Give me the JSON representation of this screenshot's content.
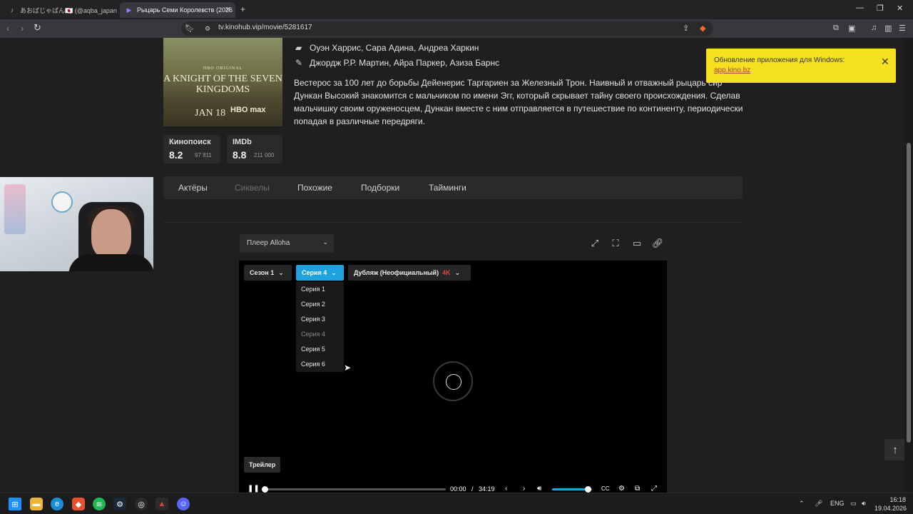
{
  "browser": {
    "tabs": [
      {
        "title": "あおばじゃぱん🇯🇵 (@aqba_japan) | Ti",
        "icon": "tiktok-icon"
      },
      {
        "title": "Рыцарь Семи Королевств (2026",
        "icon": "play-icon"
      }
    ],
    "url": "tv.kinohub.vip/movie/5281617"
  },
  "movie": {
    "cast": "Оуэн Харрис, Сара Адина, Андреа Харкин",
    "writers": "Джордж Р.Р. Мартин, Айра Паркер, Азиза Барнс",
    "description": "Вестерос за 100 лет до борьбы Дейенерис Таргариен за Железный Трон. Наивный и отважный рыцарь сир Дункан Высокий знакомится с мальчиком по имени Эгг, который скрывает тайну своего происхождения. Сделав мальчишку своим оруженосцем, Дункан вместе с ним отправляется в путешествие по континенту, периодически попадая в различные передряги.",
    "poster": {
      "hbo": "HBO ORIGINAL",
      "title": "A KNIGHT OF THE SEVEN KINGDOMS",
      "date": "JAN 18",
      "brand": "HBO max"
    },
    "ratings": [
      {
        "name": "Кинопоиск",
        "value": "8.2",
        "votes": "97 811"
      },
      {
        "name": "IMDb",
        "value": "8.8",
        "votes": "211 000"
      }
    ]
  },
  "page_tabs": [
    "Актёры",
    "Сиквелы",
    "Похожие",
    "Подборки",
    "Тайминги"
  ],
  "player": {
    "selector": "Плеер Alloha",
    "season": "Сезон 1",
    "episode": "Серия 4",
    "dub": "Дубляж (Неофициальный)",
    "quality": "4K",
    "episodes": [
      "Серия 1",
      "Серия 2",
      "Серия 3",
      "Серия 4",
      "Серия 5",
      "Серия 6"
    ],
    "trailer": "Трейлер",
    "time_current": "00:00",
    "time_separator": "/",
    "time_total": "34:19",
    "progress": 0.0,
    "volume": 0.9
  },
  "toast": {
    "text": "Обновление приложения для Windows:",
    "link": "app.kino.bz"
  },
  "taskbar": {
    "lang": "ENG",
    "time": "16:18",
    "date": "19.04.2026"
  },
  "colors": {
    "accent": "#1ea2e0",
    "toast": "#f5e11f",
    "quality": "#e0453a"
  }
}
